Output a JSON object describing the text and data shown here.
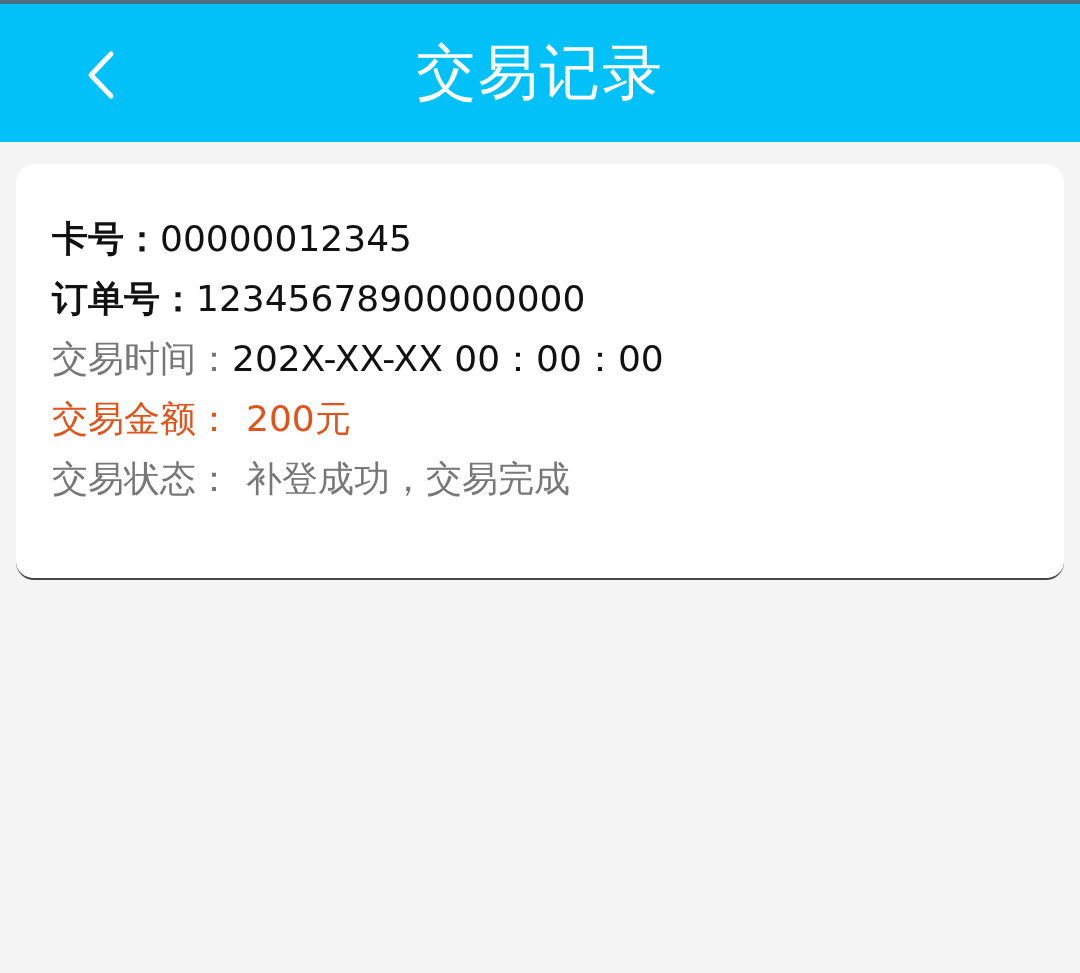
{
  "header": {
    "title": "交易记录"
  },
  "record": {
    "fields": [
      {
        "kind": "key",
        "label": "卡号：",
        "value": "00000012345"
      },
      {
        "kind": "key",
        "label": "订单号：",
        "value": "12345678900000000"
      },
      {
        "kind": "muted_label",
        "label": "交易时间：",
        "value": "202X-XX-XX 00：00：00"
      },
      {
        "kind": "amount",
        "label": "交易金额：",
        "value": "200元"
      },
      {
        "kind": "status",
        "label": "交易状态：",
        "value": "补登成功，交易完成"
      }
    ]
  }
}
